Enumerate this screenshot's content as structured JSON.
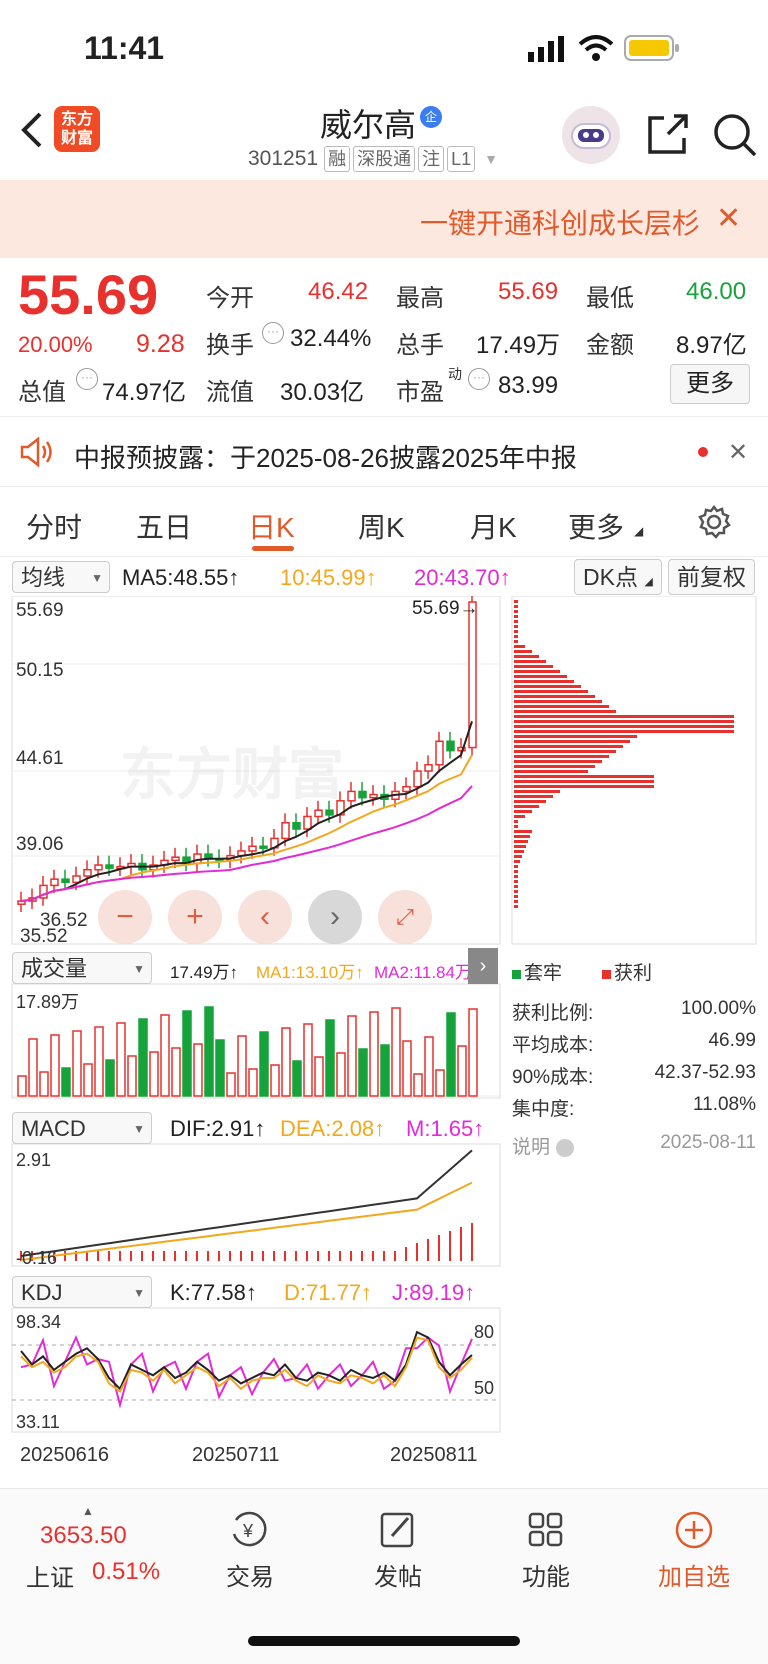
{
  "status": {
    "time": "11:41"
  },
  "header": {
    "logo_line1": "东方",
    "logo_line2": "财富",
    "title": "威尔高",
    "title_badge": "企",
    "code": "301251",
    "tags": [
      "融",
      "深股通",
      "注",
      "L1"
    ]
  },
  "banner": {
    "text": "一键开通科创成长层杉"
  },
  "quote": {
    "price": "55.69",
    "pct": "20.00%",
    "change": "9.28",
    "open_l": "今开",
    "open": "46.42",
    "high_l": "最高",
    "high": "55.69",
    "low_l": "最低",
    "low": "46.00",
    "turn_l": "换手",
    "turn": "32.44%",
    "vol_l": "总手",
    "vol": "17.49万",
    "amt_l": "金额",
    "amt": "8.97亿",
    "mcap_l": "总值",
    "mcap": "74.97亿",
    "float_l": "流值",
    "float": "30.03亿",
    "pe_l": "市盈",
    "pe_sup": "动",
    "pe": "83.99",
    "more": "更多"
  },
  "notice": {
    "text": "中报预披露：于2025-08-26披露2025年中报"
  },
  "tabs": [
    "分时",
    "五日",
    "日K",
    "周K",
    "月K",
    "更多"
  ],
  "ma": {
    "select": "均线",
    "ma5": "MA5:48.55↑",
    "ma10": "10:45.99↑",
    "ma20": "20:43.70↑",
    "dk": "DK点",
    "fq": "前复权"
  },
  "price_axis": {
    "p1": "55.69",
    "p2": "50.15",
    "p3": "44.61",
    "p4": "39.06",
    "p5": "36.52",
    "p6": "35.52",
    "last": "55.69→"
  },
  "watermark": "东方财富",
  "vol": {
    "select": "成交量",
    "v": "17.49万↑",
    "ma1": "MA1:13.10万↑",
    "ma2": "MA2:11.84万↑",
    "top": "17.89万"
  },
  "profile": {
    "legend_trap": "套牢",
    "legend_profit": "获利",
    "rows": [
      [
        "获利比例:",
        "100.00%"
      ],
      [
        "平均成本:",
        "46.99"
      ],
      [
        "90%成本:",
        "42.37-52.93"
      ],
      [
        "集中度:",
        "11.08%"
      ]
    ],
    "note": "说明",
    "date": "2025-08-11"
  },
  "macd": {
    "select": "MACD",
    "dif": "DIF:2.91↑",
    "dea": "DEA:2.08↑",
    "m": "M:1.65↑",
    "top": "2.91",
    "bottom": "-0.16"
  },
  "kdj": {
    "select": "KDJ",
    "k": "K:77.58↑",
    "d": "D:71.77↑",
    "j": "J:89.19↑",
    "top": "98.34",
    "bottom": "33.11",
    "l80": "80",
    "l50": "50"
  },
  "dates": [
    "20250616",
    "20250711",
    "20250811"
  ],
  "bottom": {
    "index_val": "3653.50",
    "index_name": "上证",
    "index_pct": "0.51%",
    "trade": "交易",
    "post": "发帖",
    "func": "功能",
    "add": "加自选"
  }
}
